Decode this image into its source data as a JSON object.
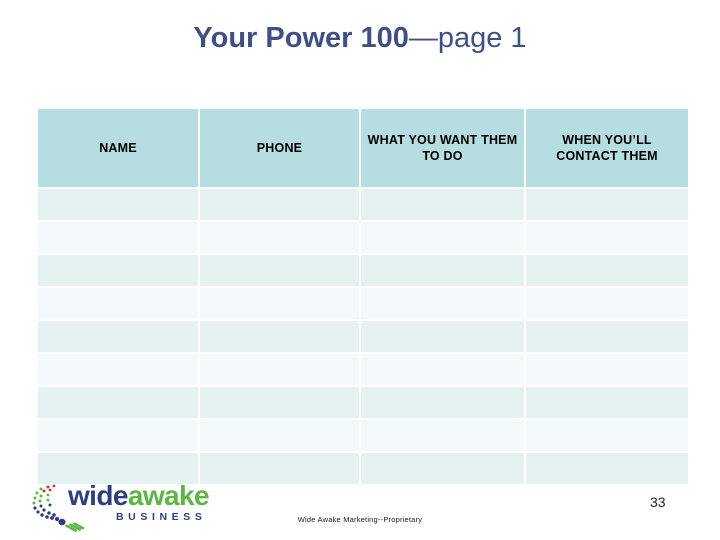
{
  "slide": {
    "title_main": "Your Power 100",
    "title_sub": "—page 1",
    "page_number": "33",
    "footer": "Wide Awake Marketing--Proprietary"
  },
  "table": {
    "headers": [
      "NAME",
      "PHONE",
      "WHAT YOU WANT THEM TO DO",
      "WHEN YOU’LL CONTACT THEM"
    ],
    "rows": [
      [
        "",
        "",
        "",
        ""
      ],
      [
        "",
        "",
        "",
        ""
      ],
      [
        "",
        "",
        "",
        ""
      ],
      [
        "",
        "",
        "",
        ""
      ],
      [
        "",
        "",
        "",
        ""
      ],
      [
        "",
        "",
        "",
        ""
      ],
      [
        "",
        "",
        "",
        ""
      ],
      [
        "",
        "",
        "",
        ""
      ],
      [
        "",
        "",
        "",
        ""
      ]
    ],
    "row_count": 9,
    "header_fill": "#b6dde2",
    "row_fill_dark": "#e6f1f2",
    "row_fill_light": "#f3f8fa"
  },
  "logo": {
    "word_part_one": "wide",
    "word_part_two": "awake",
    "tagline": "BUSINESS",
    "color_navy": "#2e3f80",
    "color_green": "#5cb646",
    "color_accent_red": "#c0392b"
  },
  "colors": {
    "title": "#404f86",
    "background": "#ffffff"
  }
}
